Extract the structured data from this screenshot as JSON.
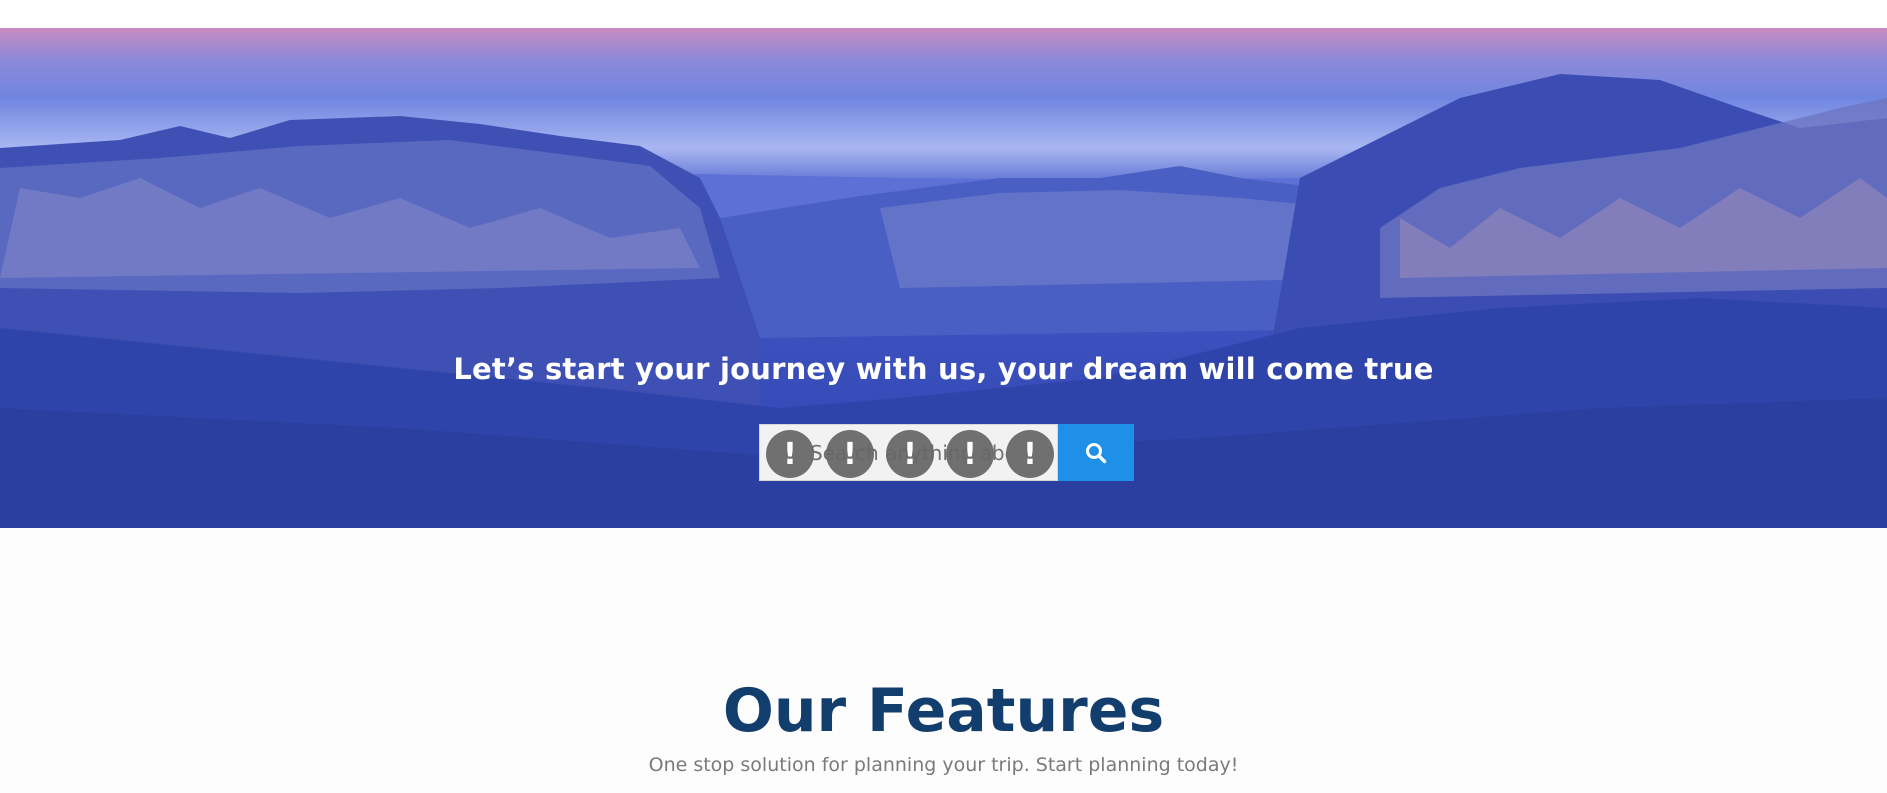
{
  "hero": {
    "tagline": "Let’s start your journey with us, your dream will come true"
  },
  "search": {
    "placeholder": "Search anything about trip",
    "warning_badges": [
      "!",
      "!",
      "!",
      "!",
      "!"
    ],
    "button_icon": "search-icon",
    "button_color": "#1e90e8"
  },
  "features": {
    "title": "Our Features",
    "subtitle": "One stop solution for planning your trip. Start planning today!"
  },
  "colors": {
    "title": "#123e6e",
    "subtitle": "#7a7a7a",
    "hero_overlay": "#3a4fbc",
    "badge": "#666666"
  }
}
